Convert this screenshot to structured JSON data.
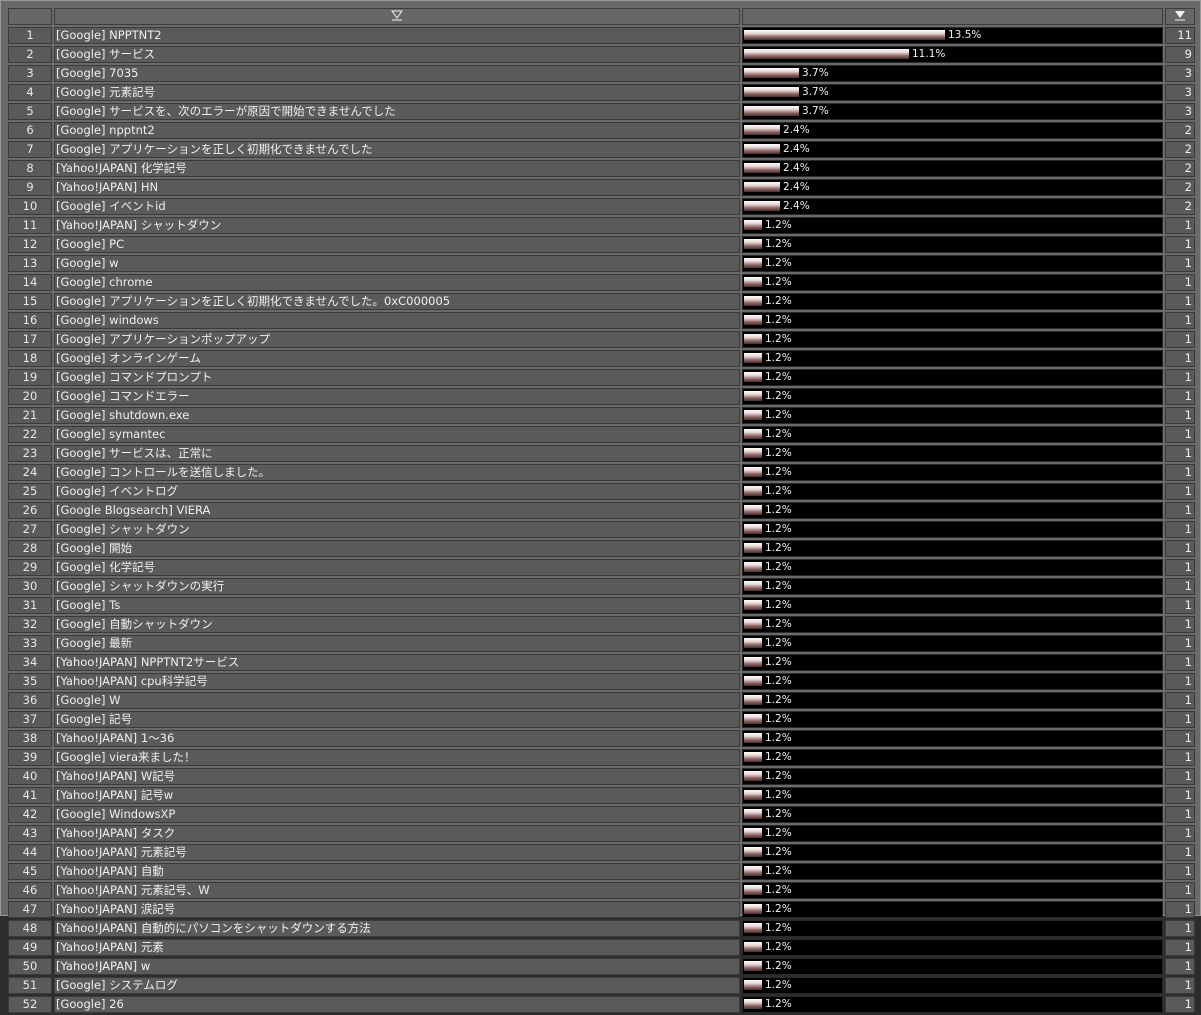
{
  "header": {
    "sort_name": "▽",
    "sort_count": "▼"
  },
  "rows": [
    {
      "rank": "1",
      "name": "[Google] NPPTNT2",
      "pct": "13.5%",
      "count": "11",
      "share": 0.135
    },
    {
      "rank": "2",
      "name": "[Google] サービス",
      "pct": "11.1%",
      "count": "9",
      "share": 0.111
    },
    {
      "rank": "3",
      "name": "[Google] 7035",
      "pct": "3.7%",
      "count": "3",
      "share": 0.037
    },
    {
      "rank": "4",
      "name": "[Google] 元素記号",
      "pct": "3.7%",
      "count": "3",
      "share": 0.037
    },
    {
      "rank": "5",
      "name": "[Google] サービスを、次のエラーが原因で開始できませんでした",
      "pct": "3.7%",
      "count": "3",
      "share": 0.037
    },
    {
      "rank": "6",
      "name": "[Google] npptnt2",
      "pct": "2.4%",
      "count": "2",
      "share": 0.024
    },
    {
      "rank": "7",
      "name": "[Google] アプリケーションを正しく初期化できませんでした",
      "pct": "2.4%",
      "count": "2",
      "share": 0.024
    },
    {
      "rank": "8",
      "name": "[Yahoo!JAPAN] 化学記号",
      "pct": "2.4%",
      "count": "2",
      "share": 0.024
    },
    {
      "rank": "9",
      "name": "[Yahoo!JAPAN] HN",
      "pct": "2.4%",
      "count": "2",
      "share": 0.024
    },
    {
      "rank": "10",
      "name": "[Google] イベントid",
      "pct": "2.4%",
      "count": "2",
      "share": 0.024
    },
    {
      "rank": "11",
      "name": "[Yahoo!JAPAN] シャットダウン",
      "pct": "1.2%",
      "count": "1",
      "share": 0.012
    },
    {
      "rank": "12",
      "name": "[Google] PC",
      "pct": "1.2%",
      "count": "1",
      "share": 0.012
    },
    {
      "rank": "13",
      "name": "[Google] w",
      "pct": "1.2%",
      "count": "1",
      "share": 0.012
    },
    {
      "rank": "14",
      "name": "[Google] chrome",
      "pct": "1.2%",
      "count": "1",
      "share": 0.012
    },
    {
      "rank": "15",
      "name": "[Google] アプリケーションを正しく初期化できませんでした。0xC000005",
      "pct": "1.2%",
      "count": "1",
      "share": 0.012
    },
    {
      "rank": "16",
      "name": "[Google] windows",
      "pct": "1.2%",
      "count": "1",
      "share": 0.012
    },
    {
      "rank": "17",
      "name": "[Google] アプリケーションポップアップ",
      "pct": "1.2%",
      "count": "1",
      "share": 0.012
    },
    {
      "rank": "18",
      "name": "[Google] オンラインゲーム",
      "pct": "1.2%",
      "count": "1",
      "share": 0.012
    },
    {
      "rank": "19",
      "name": "[Google] コマンドプロンプト",
      "pct": "1.2%",
      "count": "1",
      "share": 0.012
    },
    {
      "rank": "20",
      "name": "[Google] コマンドエラー",
      "pct": "1.2%",
      "count": "1",
      "share": 0.012
    },
    {
      "rank": "21",
      "name": "[Google] shutdown.exe",
      "pct": "1.2%",
      "count": "1",
      "share": 0.012
    },
    {
      "rank": "22",
      "name": "[Google] symantec",
      "pct": "1.2%",
      "count": "1",
      "share": 0.012
    },
    {
      "rank": "23",
      "name": "[Google] サービスは、正常に",
      "pct": "1.2%",
      "count": "1",
      "share": 0.012
    },
    {
      "rank": "24",
      "name": "[Google] コントロールを送信しました。",
      "pct": "1.2%",
      "count": "1",
      "share": 0.012
    },
    {
      "rank": "25",
      "name": "[Google] イベントログ",
      "pct": "1.2%",
      "count": "1",
      "share": 0.012
    },
    {
      "rank": "26",
      "name": "[Google Blogsearch] VIERA",
      "pct": "1.2%",
      "count": "1",
      "share": 0.012
    },
    {
      "rank": "27",
      "name": "[Google] シャットダウン",
      "pct": "1.2%",
      "count": "1",
      "share": 0.012
    },
    {
      "rank": "28",
      "name": "[Google] 開始",
      "pct": "1.2%",
      "count": "1",
      "share": 0.012
    },
    {
      "rank": "29",
      "name": "[Google] 化学記号",
      "pct": "1.2%",
      "count": "1",
      "share": 0.012
    },
    {
      "rank": "30",
      "name": "[Google] シャットダウンの実行",
      "pct": "1.2%",
      "count": "1",
      "share": 0.012
    },
    {
      "rank": "31",
      "name": "[Google] Ts",
      "pct": "1.2%",
      "count": "1",
      "share": 0.012
    },
    {
      "rank": "32",
      "name": "[Google] 自動シャットダウン",
      "pct": "1.2%",
      "count": "1",
      "share": 0.012
    },
    {
      "rank": "33",
      "name": "[Google] 最新",
      "pct": "1.2%",
      "count": "1",
      "share": 0.012
    },
    {
      "rank": "34",
      "name": "[Yahoo!JAPAN] NPPTNT2サービス",
      "pct": "1.2%",
      "count": "1",
      "share": 0.012
    },
    {
      "rank": "35",
      "name": "[Yahoo!JAPAN] cpu科学記号",
      "pct": "1.2%",
      "count": "1",
      "share": 0.012
    },
    {
      "rank": "36",
      "name": "[Google] W",
      "pct": "1.2%",
      "count": "1",
      "share": 0.012
    },
    {
      "rank": "37",
      "name": "[Google] 記号",
      "pct": "1.2%",
      "count": "1",
      "share": 0.012
    },
    {
      "rank": "38",
      "name": "[Yahoo!JAPAN] 1〜36",
      "pct": "1.2%",
      "count": "1",
      "share": 0.012
    },
    {
      "rank": "39",
      "name": "[Google] viera来ました！",
      "pct": "1.2%",
      "count": "1",
      "share": 0.012
    },
    {
      "rank": "40",
      "name": "[Yahoo!JAPAN] W記号",
      "pct": "1.2%",
      "count": "1",
      "share": 0.012
    },
    {
      "rank": "41",
      "name": "[Yahoo!JAPAN] 記号w",
      "pct": "1.2%",
      "count": "1",
      "share": 0.012
    },
    {
      "rank": "42",
      "name": "[Google] WindowsXP",
      "pct": "1.2%",
      "count": "1",
      "share": 0.012
    },
    {
      "rank": "43",
      "name": "[Yahoo!JAPAN] タスク",
      "pct": "1.2%",
      "count": "1",
      "share": 0.012
    },
    {
      "rank": "44",
      "name": "[Yahoo!JAPAN] 元素記号",
      "pct": "1.2%",
      "count": "1",
      "share": 0.012
    },
    {
      "rank": "45",
      "name": "[Yahoo!JAPAN] 自動",
      "pct": "1.2%",
      "count": "1",
      "share": 0.012
    },
    {
      "rank": "46",
      "name": "[Yahoo!JAPAN] 元素記号、W",
      "pct": "1.2%",
      "count": "1",
      "share": 0.012
    },
    {
      "rank": "47",
      "name": "[Yahoo!JAPAN] 涙記号",
      "pct": "1.2%",
      "count": "1",
      "share": 0.012
    },
    {
      "rank": "48",
      "name": "[Yahoo!JAPAN] 自動的にパソコンをシャットダウンする方法",
      "pct": "1.2%",
      "count": "1",
      "share": 0.012
    },
    {
      "rank": "49",
      "name": "[Yahoo!JAPAN] 元素",
      "pct": "1.2%",
      "count": "1",
      "share": 0.012
    },
    {
      "rank": "50",
      "name": "[Yahoo!JAPAN] w",
      "pct": "1.2%",
      "count": "1",
      "share": 0.012
    },
    {
      "rank": "51",
      "name": "[Google] システムログ",
      "pct": "1.2%",
      "count": "1",
      "share": 0.012
    },
    {
      "rank": "52",
      "name": "[Google] 26",
      "pct": "1.2%",
      "count": "1",
      "share": 0.012
    }
  ]
}
